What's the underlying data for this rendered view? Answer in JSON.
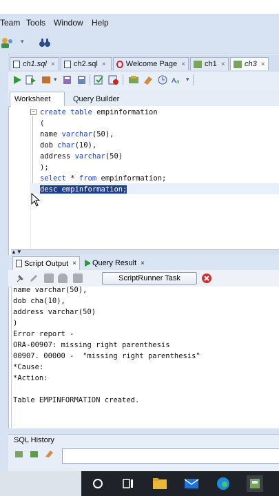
{
  "menu": [
    "Team",
    "Tools",
    "Window",
    "Help"
  ],
  "doc_tabs": [
    {
      "label": "ch1.sql"
    },
    {
      "label": "ch2.sql"
    },
    {
      "label": "Welcome Page"
    },
    {
      "label": "ch1"
    },
    {
      "label": "ch3"
    }
  ],
  "worksheet_tabs": [
    "Worksheet",
    "Query Builder"
  ],
  "editor": {
    "lines": [
      "create table empinformation",
      "(",
      "name varchar(50),",
      "dob char(10),",
      "address varchar(50)",
      ");",
      "select * from empinformation;",
      "desc empinformation;"
    ]
  },
  "output_tabs": [
    "Script Output",
    "Query Result"
  ],
  "output_toolbar": {
    "task_label": "ScriptRunner Task"
  },
  "output": {
    "lines": [
      "name varchar(50),",
      "dob cha(10),",
      "address varchar(50)",
      ")",
      "Error report -",
      "ORA-00907: missing right parenthesis",
      "00907. 00000 -  \"missing right parenthesis\"",
      "*Cause:",
      "*Action:",
      "",
      "Table EMPINFORMATION created."
    ]
  },
  "sql_history": {
    "title": "SQL History"
  },
  "colors": {
    "selection": "#1e3f8f",
    "keyword": "#1f3fb8",
    "ide_blue": "#d7e3f2",
    "taskbar": "#1f2329"
  }
}
